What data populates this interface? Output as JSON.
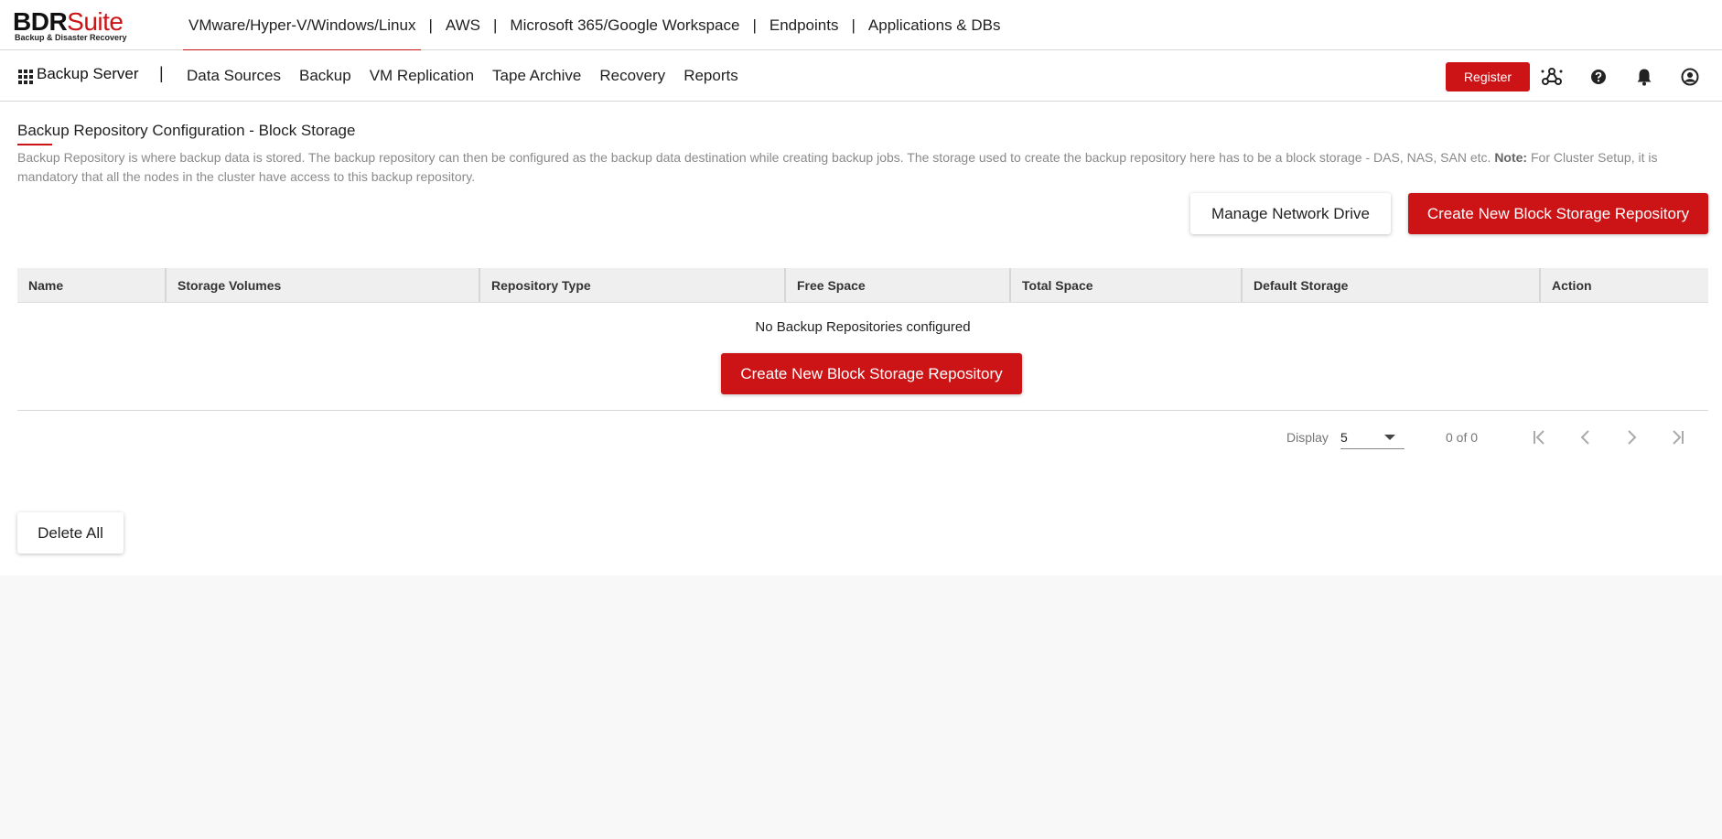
{
  "brand": {
    "name_bold": "BDR",
    "name_light": "Suite",
    "tagline": "Backup & Disaster Recovery"
  },
  "product_tabs": [
    {
      "label": "VMware/Hyper-V/Windows/Linux",
      "active": true
    },
    {
      "label": "AWS"
    },
    {
      "label": "Microsoft 365/Google Workspace"
    },
    {
      "label": "Endpoints"
    },
    {
      "label": "Applications & DBs"
    }
  ],
  "separator": "|",
  "nav": {
    "server_label": "Backup Server",
    "items": [
      "Data Sources",
      "Backup",
      "VM Replication",
      "Tape Archive",
      "Recovery",
      "Reports"
    ],
    "register_label": "Register",
    "icons": [
      "cluster-icon",
      "help-icon",
      "bell-icon",
      "user-icon"
    ]
  },
  "page": {
    "title": "Backup Repository Configuration - Block Storage",
    "description": "Backup Repository is where backup data is stored. The backup repository can then be configured as the backup data destination while creating backup jobs. The storage used to create the backup repository here has to be a block storage - DAS, NAS, SAN etc.",
    "note_label": "Note:",
    "note_text": "For Cluster Setup, it is mandatory that all the nodes in the cluster have access to this backup repository.",
    "manage_drive_label": "Manage Network Drive",
    "create_label": "Create New Block Storage Repository",
    "delete_all_label": "Delete All"
  },
  "table": {
    "columns": [
      "Name",
      "Storage Volumes",
      "Repository Type",
      "Free Space",
      "Total Space",
      "Default Storage",
      "Action"
    ],
    "empty_message": "No Backup Repositories configured",
    "empty_create_label": "Create New Block Storage Repository"
  },
  "pagination": {
    "display_label": "Display",
    "page_size": "5",
    "count_text": "0 of 0"
  },
  "colors": {
    "accent": "#cc1417",
    "background": "#f8f8f8",
    "header_bg": "#efefef"
  }
}
